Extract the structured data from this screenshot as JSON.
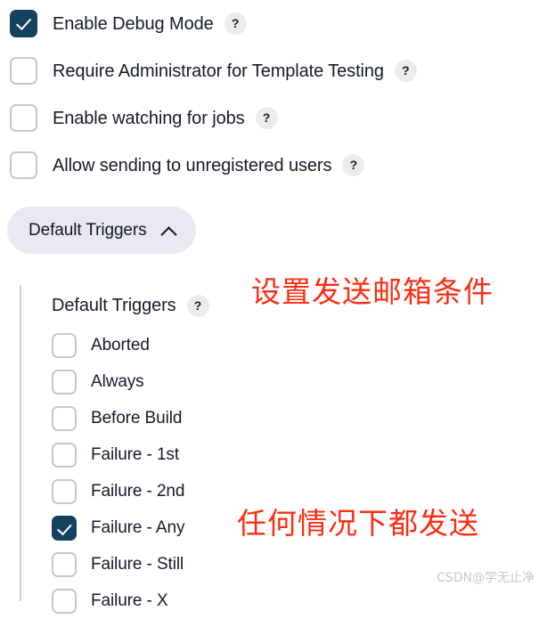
{
  "settings": {
    "items": [
      {
        "label": "Enable Debug Mode",
        "checked": true,
        "help": "?"
      },
      {
        "label": "Require Administrator for Template Testing",
        "checked": false,
        "help": "?"
      },
      {
        "label": "Enable watching for jobs",
        "checked": false,
        "help": "?"
      },
      {
        "label": "Allow sending to unregistered users",
        "checked": false,
        "help": "?"
      }
    ]
  },
  "section_toggle": {
    "label": "Default Triggers",
    "expanded": true,
    "chevron_icon": "chevron-up-icon"
  },
  "triggers_group": {
    "header_label": "Default Triggers",
    "header_help": "?",
    "items": [
      {
        "label": "Aborted",
        "checked": false
      },
      {
        "label": "Always",
        "checked": false
      },
      {
        "label": "Before Build",
        "checked": false
      },
      {
        "label": "Failure - 1st",
        "checked": false
      },
      {
        "label": "Failure - 2nd",
        "checked": false
      },
      {
        "label": "Failure - Any",
        "checked": true
      },
      {
        "label": "Failure - Still",
        "checked": false
      },
      {
        "label": "Failure - X",
        "checked": false
      }
    ]
  },
  "annotations": [
    {
      "text": "设置发送邮箱条件",
      "color": "#fb2e13"
    },
    {
      "text": "任何情况下都发送",
      "color": "#fb2e13"
    }
  ],
  "watermark": {
    "text": "CSDN@学无止净"
  },
  "colors": {
    "checkbox_checked": "#15425f",
    "checkbox_border": "#c2c9d1",
    "pill_background": "#e9e9f2",
    "annotation_red": "#fb2e13",
    "text": "#141c29"
  }
}
